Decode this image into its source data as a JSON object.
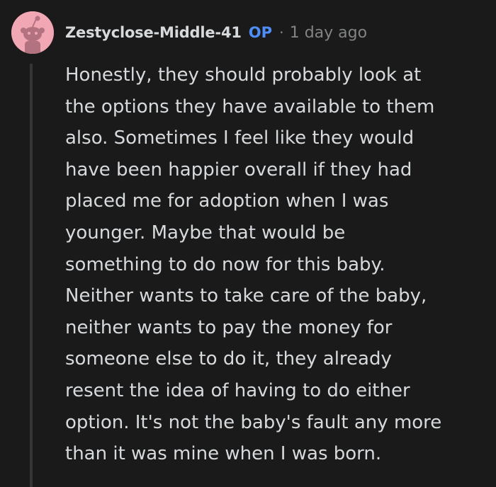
{
  "comment": {
    "author": "Zestyclose-Middle-41",
    "op_badge": "OP",
    "separator": "·",
    "timestamp": "1 day ago",
    "avatar_icon": "reddit-snoo-avatar-icon",
    "avatar_color": "#f2a7b5",
    "op_color": "#4f8ef7",
    "body_lines": [
      "Honestly, they should probably look at",
      "the options they have available to them",
      "also. Sometimes I feel like they would",
      "have been happier overall if they had",
      "placed me for adoption when I was",
      "younger. Maybe that would be",
      "something to do now for this baby.",
      "Neither wants to take care of the baby,",
      "neither wants to pay the money for",
      "someone else to do it, they already",
      "resent the idea of having to do either",
      "option. It's not the baby's fault any more",
      "than it was mine when I was born."
    ]
  }
}
